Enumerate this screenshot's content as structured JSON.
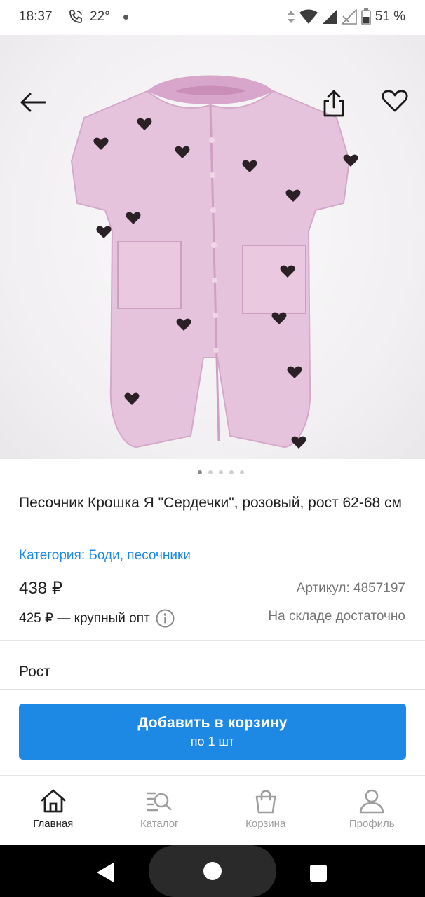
{
  "status_bar": {
    "time": "18:37",
    "temperature": "22°",
    "battery": "51 %",
    "icons": [
      "phone-call-icon",
      "sun-icon",
      "data-arrows-icon",
      "wifi-icon",
      "signal-icon",
      "signal-empty-icon",
      "battery-icon"
    ]
  },
  "hero": {
    "icons": [
      "back-arrow-icon",
      "share-icon",
      "heart-icon"
    ],
    "carousel": {
      "count": 5,
      "active_index": 0
    }
  },
  "product": {
    "title": "Песочник Крошка Я \"Сердечки\", розовый, рост 62-68 см",
    "category": "Категория: Боди, песочники",
    "price": "438 ₽",
    "sku": "Артикул: 4857197",
    "wholesale": "425 ₽ — крупный опт",
    "stock": "На складе достаточно",
    "size_label": "Рост"
  },
  "cart_button": {
    "label": "Добавить в корзину",
    "sublabel": "по 1 шт"
  },
  "bottom_nav": {
    "items": [
      {
        "label": "Главная",
        "icon": "home-icon",
        "active": true
      },
      {
        "label": "Каталог",
        "icon": "catalog-search-icon",
        "active": false
      },
      {
        "label": "Корзина",
        "icon": "cart-bag-icon",
        "active": false
      },
      {
        "label": "Профиль",
        "icon": "profile-icon",
        "active": false
      }
    ]
  },
  "colors": {
    "accent": "#1e88e5",
    "text": "#212121",
    "muted": "#757575",
    "inactive_nav": "#9e9e9e",
    "garment": "#e6c3dd"
  }
}
